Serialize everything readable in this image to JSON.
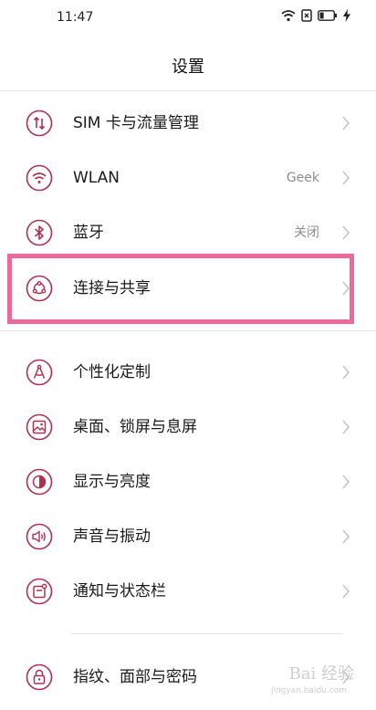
{
  "status_bar": {
    "time": "11:47"
  },
  "header": {
    "title": "设置"
  },
  "items": [
    {
      "label": "SIM 卡与流量管理",
      "value": ""
    },
    {
      "label": "WLAN",
      "value": "Geek"
    },
    {
      "label": "蓝牙",
      "value": "关闭"
    },
    {
      "label": "连接与共享",
      "value": ""
    },
    {
      "label": "个性化定制",
      "value": ""
    },
    {
      "label": "桌面、锁屏与息屏",
      "value": ""
    },
    {
      "label": "显示与亮度",
      "value": ""
    },
    {
      "label": "声音与振动",
      "value": ""
    },
    {
      "label": "通知与状态栏",
      "value": ""
    },
    {
      "label": "指纹、面部与密码",
      "value": ""
    }
  ],
  "icons": [
    "sim-data-icon",
    "wifi-icon",
    "bluetooth-icon",
    "share-icon",
    "personalize-icon",
    "wallpaper-icon",
    "display-icon",
    "sound-icon",
    "notification-icon",
    "lock-icon"
  ],
  "highlighted_item": "连接与共享",
  "colors": {
    "accent": "#b03050",
    "highlight_border": "#ec6a9a",
    "value_text": "#8c8c8c"
  },
  "watermark": {
    "text": "Bai 经验",
    "subtext": "jingyan.baidu.com"
  }
}
